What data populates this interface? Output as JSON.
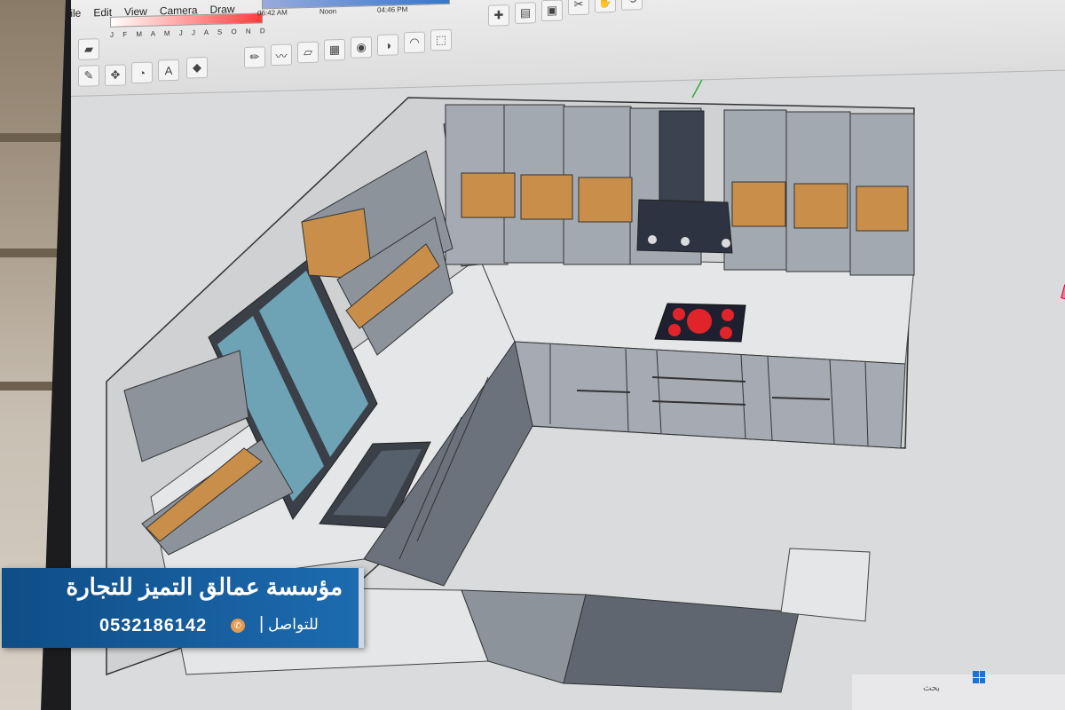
{
  "menu": {
    "items": [
      "File",
      "Edit",
      "View",
      "Camera",
      "Draw"
    ]
  },
  "shadow_settings": {
    "months": "J F M A M J J A S O N D",
    "time_start": "06:42 AM",
    "time_mid": "Noon",
    "time_end": "04:46 PM"
  },
  "toolbar_icons": [
    "eraser-icon",
    "paint-icon",
    "pencil-icon",
    "freehand-icon",
    "rectangle-icon",
    "circle-icon",
    "arc-icon",
    "pie-icon",
    "push-pull-icon",
    "move-icon",
    "rotate-icon",
    "scale-icon",
    "text-icon",
    "tape-icon",
    "orbit-icon",
    "pan-icon",
    "save-icon",
    "folder-icon",
    "scissors-icon",
    "copy-icon"
  ],
  "banner": {
    "company_name": "مؤسسة عمالق التميز للتجارة",
    "contact_label": "للتواصل",
    "separator": "|",
    "phone": "0532186142"
  },
  "taskbar": {
    "search_text": "بحث"
  },
  "colors": {
    "banner_bg": "#1d6bb0",
    "countertop": "#e4e6e8",
    "cabinet": "#9aa0a8",
    "wood": "#c98f4a",
    "glass": "#6ea3b5",
    "hob": "#1e2030",
    "burner": "#e0242a"
  }
}
